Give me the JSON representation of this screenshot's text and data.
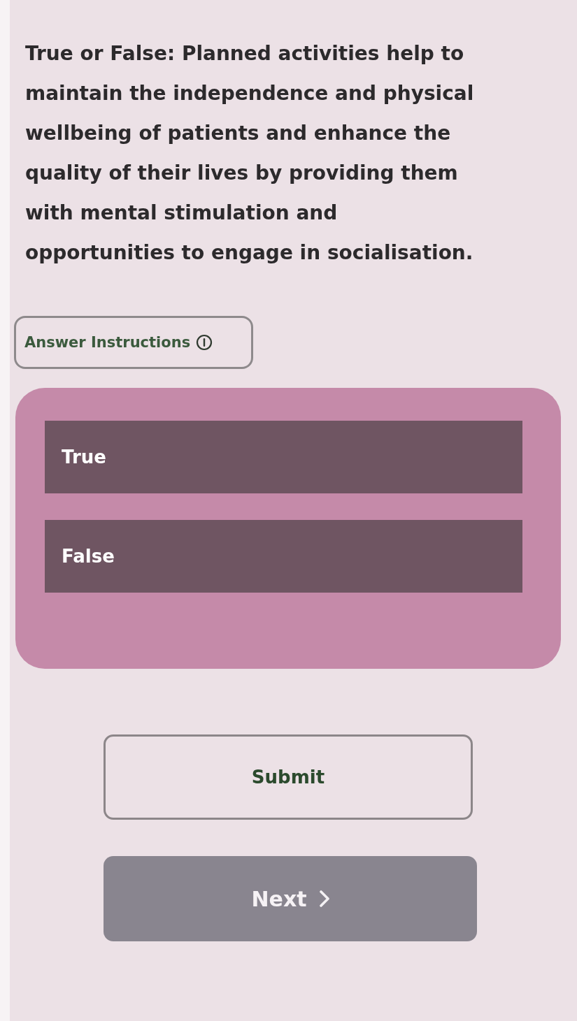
{
  "question": {
    "text": "True or False: Planned activities help to maintain the independence and physical wellbeing of patients and enhance the quality of their lives by providing them with mental stimulation and opportunities to engage in socialisation."
  },
  "answer_instructions": {
    "label": "Answer Instructions"
  },
  "options": [
    {
      "label": "True",
      "selected": false
    },
    {
      "label": "False",
      "selected": false
    }
  ],
  "buttons": [
    {
      "label": "Submit",
      "kind": "outline",
      "disabled": false
    },
    {
      "label": "Next",
      "kind": "forward",
      "disabled": true
    }
  ]
}
